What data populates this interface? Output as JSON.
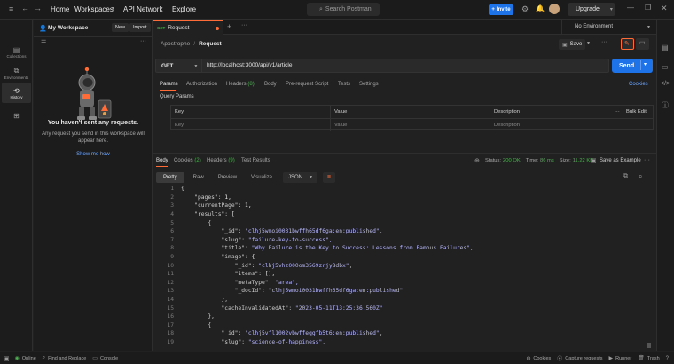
{
  "topbar": {
    "home": "Home",
    "workspaces": "Workspaces",
    "api_network": "API Network",
    "explore": "Explore",
    "search_placeholder": "Search Postman",
    "invite": "Invite",
    "upgrade": "Upgrade"
  },
  "rail": {
    "items": [
      {
        "label": "Collections",
        "icon": "collections-icon"
      },
      {
        "label": "Environments",
        "icon": "environments-icon"
      },
      {
        "label": "History",
        "icon": "history-icon"
      },
      {
        "label": "",
        "icon": "apps-icon"
      }
    ]
  },
  "sidebar": {
    "workspace": "My Workspace",
    "new_label": "New",
    "import_label": "Import",
    "empty_title": "You haven't sent any requests.",
    "empty_desc": "Any request you send in this workspace will appear here.",
    "show_me_how": "Show me how"
  },
  "tabs": {
    "method": "GET",
    "name": "Request",
    "environment": "No Environment"
  },
  "request": {
    "breadcrumb_parent": "Apostrophe",
    "breadcrumb_sep": "/",
    "breadcrumb_current": "Request",
    "save": "Save",
    "method": "GET",
    "url": "http://localhost:3000/api/v1/article",
    "send": "Send",
    "tabs": [
      "Params",
      "Authorization",
      "Headers",
      "Body",
      "Pre-request Script",
      "Tests",
      "Settings"
    ],
    "headers_count": "(8)",
    "cookies": "Cookies",
    "query_params": "Query Params",
    "table": {
      "headers": [
        "Key",
        "Value",
        "Description"
      ],
      "bulk_edit": "Bulk Edit",
      "placeholders": [
        "Key",
        "Value",
        "Description"
      ]
    }
  },
  "response": {
    "tabs": [
      "Body",
      "Cookies",
      "Headers",
      "Test Results"
    ],
    "cookies_count": "(2)",
    "headers_count": "(9)",
    "status_label": "Status:",
    "status": "200 OK",
    "time_label": "Time:",
    "time": "86 ms",
    "size_label": "Size:",
    "size": "11.22 KB",
    "save_example": "Save as Example",
    "view_tabs": [
      "Pretty",
      "Raw",
      "Preview",
      "Visualize"
    ],
    "format": "JSON",
    "lines": [
      "{",
      "    \"pages\": 1,",
      "    \"currentPage\": 1,",
      "    \"results\": [",
      "        {",
      "            \"_id\": \"clhj5wmoi0031bwffh65df6ga:en:published\",",
      "            \"slug\": \"failure-key-to-success\",",
      "            \"title\": \"Why Failure is the Key to Success: Lessons from Famous Failures\",",
      "            \"image\": {",
      "                \"_id\": \"clhj5vhz000om3569zrjy8dbx\",",
      "                \"items\": [],",
      "                \"metaType\": \"area\",",
      "                \"_docId\": \"clhj5wmoi0031bwffh65df6ga:en:published\"",
      "            },",
      "            \"cacheInvalidatedAt\": \"2023-05-11T13:25:36.560Z\"",
      "        },",
      "        {",
      "            \"_id\": \"clhj5vfl1002vbwffeggfb5t6:en:published\",",
      "            \"slug\": \"science-of-happiness\","
    ]
  },
  "statusbar": {
    "online": "Online",
    "find_replace": "Find and Replace",
    "console": "Console",
    "cookies": "Cookies",
    "capture": "Capture requests",
    "runner": "Runner",
    "trash": "Trash"
  },
  "colors": {
    "accent": "#ff6c37",
    "primary": "#1f73e8",
    "status_ok": "#4caf50"
  }
}
